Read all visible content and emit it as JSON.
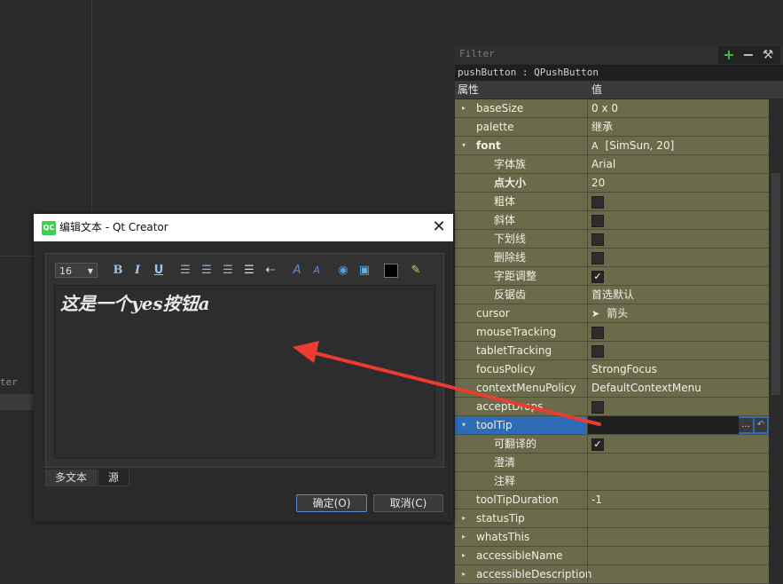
{
  "left_pane": {
    "filter_text": "ter"
  },
  "property_editor": {
    "filter_placeholder": "Filter",
    "object_title": "pushButton : QPushButton",
    "header": {
      "property": "属性",
      "value": "值"
    },
    "tool_icons": [
      "plus-icon",
      "minus-icon",
      "wrench-icon"
    ],
    "rows": [
      {
        "name": "baseSize",
        "value": "0 x 0",
        "arrow": "▸",
        "indent": 0,
        "bold": false
      },
      {
        "name": "palette",
        "value": "继承",
        "arrow": "",
        "indent": 0,
        "bold": false
      },
      {
        "name": "font",
        "value": "[SimSun, 20]",
        "arrow": "▾",
        "indent": 0,
        "bold": true,
        "value_icon": "Α"
      },
      {
        "name": "字体族",
        "value": "Arial",
        "arrow": "",
        "indent": 1,
        "bold": false
      },
      {
        "name": "点大小",
        "value": "20",
        "arrow": "",
        "indent": 1,
        "bold": true
      },
      {
        "name": "粗体",
        "value": "",
        "arrow": "",
        "indent": 1,
        "bold": false,
        "checkbox": false
      },
      {
        "name": "斜体",
        "value": "",
        "arrow": "",
        "indent": 1,
        "bold": false,
        "checkbox": false
      },
      {
        "name": "下划线",
        "value": "",
        "arrow": "",
        "indent": 1,
        "bold": false,
        "checkbox": false
      },
      {
        "name": "删除线",
        "value": "",
        "arrow": "",
        "indent": 1,
        "bold": false,
        "checkbox": false
      },
      {
        "name": "字距调整",
        "value": "",
        "arrow": "",
        "indent": 1,
        "bold": false,
        "checkbox": true
      },
      {
        "name": "反锯齿",
        "value": "首选默认",
        "arrow": "",
        "indent": 1,
        "bold": false
      },
      {
        "name": "cursor",
        "value": "箭头",
        "arrow": "",
        "indent": 0,
        "bold": false,
        "value_icon": "➤"
      },
      {
        "name": "mouseTracking",
        "value": "",
        "arrow": "",
        "indent": 0,
        "bold": false,
        "checkbox": false
      },
      {
        "name": "tabletTracking",
        "value": "",
        "arrow": "",
        "indent": 0,
        "bold": false,
        "checkbox": false
      },
      {
        "name": "focusPolicy",
        "value": "StrongFocus",
        "arrow": "",
        "indent": 0,
        "bold": false
      },
      {
        "name": "contextMenuPolicy",
        "value": "DefaultContextMenu",
        "arrow": "",
        "indent": 0,
        "bold": false
      },
      {
        "name": "acceptDrops",
        "value": "",
        "arrow": "",
        "indent": 0,
        "bold": false,
        "checkbox": false
      },
      {
        "name": "toolTip",
        "value": "",
        "arrow": "▾",
        "indent": 0,
        "bold": false,
        "selected": true
      },
      {
        "name": "可翻译的",
        "value": "",
        "arrow": "",
        "indent": 1,
        "bold": false,
        "checkbox": true
      },
      {
        "name": "澄清",
        "value": "",
        "arrow": "",
        "indent": 1,
        "bold": false
      },
      {
        "name": "注释",
        "value": "",
        "arrow": "",
        "indent": 1,
        "bold": false
      },
      {
        "name": "toolTipDuration",
        "value": "-1",
        "arrow": "",
        "indent": 0,
        "bold": false
      },
      {
        "name": "statusTip",
        "value": "",
        "arrow": "▸",
        "indent": 0,
        "bold": false
      },
      {
        "name": "whatsThis",
        "value": "",
        "arrow": "▸",
        "indent": 0,
        "bold": false
      },
      {
        "name": "accessibleName",
        "value": "",
        "arrow": "▸",
        "indent": 0,
        "bold": false
      },
      {
        "name": "accessibleDescription",
        "value": "",
        "arrow": "▸",
        "indent": 0,
        "bold": false
      }
    ],
    "tooltip_ellipsis": "...",
    "tooltip_reset": "↶"
  },
  "dialog": {
    "logo": "QC",
    "title": "编辑文本 - Qt Creator",
    "close": "✕",
    "font_size": "16",
    "toolbar": [
      "bold-button",
      "italic-button",
      "underline-button",
      "align-left-button",
      "align-center-button",
      "align-right-button",
      "justify-button",
      "rtl-button",
      "increase-size-button",
      "decrease-size-button",
      "link-button",
      "image-button",
      "color-button",
      "simplify-button"
    ],
    "toolbar_glyphs": {
      "bold": "B",
      "italic": "I",
      "underline": "U"
    },
    "content": "这是一个yes按钮a",
    "tabs": [
      "多文本",
      "源"
    ],
    "ok": "确定(O)",
    "cancel": "取消(C)"
  }
}
